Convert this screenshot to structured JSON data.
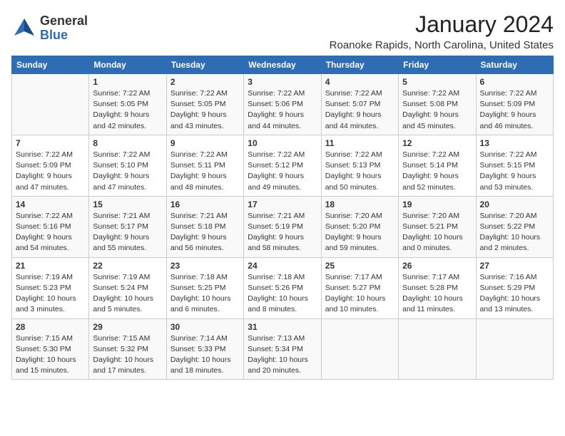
{
  "logo": {
    "general": "General",
    "blue": "Blue"
  },
  "title": "January 2024",
  "location": "Roanoke Rapids, North Carolina, United States",
  "weekdays": [
    "Sunday",
    "Monday",
    "Tuesday",
    "Wednesday",
    "Thursday",
    "Friday",
    "Saturday"
  ],
  "weeks": [
    [
      {
        "day": "",
        "info": ""
      },
      {
        "day": "1",
        "info": "Sunrise: 7:22 AM\nSunset: 5:05 PM\nDaylight: 9 hours\nand 42 minutes."
      },
      {
        "day": "2",
        "info": "Sunrise: 7:22 AM\nSunset: 5:05 PM\nDaylight: 9 hours\nand 43 minutes."
      },
      {
        "day": "3",
        "info": "Sunrise: 7:22 AM\nSunset: 5:06 PM\nDaylight: 9 hours\nand 44 minutes."
      },
      {
        "day": "4",
        "info": "Sunrise: 7:22 AM\nSunset: 5:07 PM\nDaylight: 9 hours\nand 44 minutes."
      },
      {
        "day": "5",
        "info": "Sunrise: 7:22 AM\nSunset: 5:08 PM\nDaylight: 9 hours\nand 45 minutes."
      },
      {
        "day": "6",
        "info": "Sunrise: 7:22 AM\nSunset: 5:09 PM\nDaylight: 9 hours\nand 46 minutes."
      }
    ],
    [
      {
        "day": "7",
        "info": "Sunrise: 7:22 AM\nSunset: 5:09 PM\nDaylight: 9 hours\nand 47 minutes."
      },
      {
        "day": "8",
        "info": "Sunrise: 7:22 AM\nSunset: 5:10 PM\nDaylight: 9 hours\nand 47 minutes."
      },
      {
        "day": "9",
        "info": "Sunrise: 7:22 AM\nSunset: 5:11 PM\nDaylight: 9 hours\nand 48 minutes."
      },
      {
        "day": "10",
        "info": "Sunrise: 7:22 AM\nSunset: 5:12 PM\nDaylight: 9 hours\nand 49 minutes."
      },
      {
        "day": "11",
        "info": "Sunrise: 7:22 AM\nSunset: 5:13 PM\nDaylight: 9 hours\nand 50 minutes."
      },
      {
        "day": "12",
        "info": "Sunrise: 7:22 AM\nSunset: 5:14 PM\nDaylight: 9 hours\nand 52 minutes."
      },
      {
        "day": "13",
        "info": "Sunrise: 7:22 AM\nSunset: 5:15 PM\nDaylight: 9 hours\nand 53 minutes."
      }
    ],
    [
      {
        "day": "14",
        "info": "Sunrise: 7:22 AM\nSunset: 5:16 PM\nDaylight: 9 hours\nand 54 minutes."
      },
      {
        "day": "15",
        "info": "Sunrise: 7:21 AM\nSunset: 5:17 PM\nDaylight: 9 hours\nand 55 minutes."
      },
      {
        "day": "16",
        "info": "Sunrise: 7:21 AM\nSunset: 5:18 PM\nDaylight: 9 hours\nand 56 minutes."
      },
      {
        "day": "17",
        "info": "Sunrise: 7:21 AM\nSunset: 5:19 PM\nDaylight: 9 hours\nand 58 minutes."
      },
      {
        "day": "18",
        "info": "Sunrise: 7:20 AM\nSunset: 5:20 PM\nDaylight: 9 hours\nand 59 minutes."
      },
      {
        "day": "19",
        "info": "Sunrise: 7:20 AM\nSunset: 5:21 PM\nDaylight: 10 hours\nand 0 minutes."
      },
      {
        "day": "20",
        "info": "Sunrise: 7:20 AM\nSunset: 5:22 PM\nDaylight: 10 hours\nand 2 minutes."
      }
    ],
    [
      {
        "day": "21",
        "info": "Sunrise: 7:19 AM\nSunset: 5:23 PM\nDaylight: 10 hours\nand 3 minutes."
      },
      {
        "day": "22",
        "info": "Sunrise: 7:19 AM\nSunset: 5:24 PM\nDaylight: 10 hours\nand 5 minutes."
      },
      {
        "day": "23",
        "info": "Sunrise: 7:18 AM\nSunset: 5:25 PM\nDaylight: 10 hours\nand 6 minutes."
      },
      {
        "day": "24",
        "info": "Sunrise: 7:18 AM\nSunset: 5:26 PM\nDaylight: 10 hours\nand 8 minutes."
      },
      {
        "day": "25",
        "info": "Sunrise: 7:17 AM\nSunset: 5:27 PM\nDaylight: 10 hours\nand 10 minutes."
      },
      {
        "day": "26",
        "info": "Sunrise: 7:17 AM\nSunset: 5:28 PM\nDaylight: 10 hours\nand 11 minutes."
      },
      {
        "day": "27",
        "info": "Sunrise: 7:16 AM\nSunset: 5:29 PM\nDaylight: 10 hours\nand 13 minutes."
      }
    ],
    [
      {
        "day": "28",
        "info": "Sunrise: 7:15 AM\nSunset: 5:30 PM\nDaylight: 10 hours\nand 15 minutes."
      },
      {
        "day": "29",
        "info": "Sunrise: 7:15 AM\nSunset: 5:32 PM\nDaylight: 10 hours\nand 17 minutes."
      },
      {
        "day": "30",
        "info": "Sunrise: 7:14 AM\nSunset: 5:33 PM\nDaylight: 10 hours\nand 18 minutes."
      },
      {
        "day": "31",
        "info": "Sunrise: 7:13 AM\nSunset: 5:34 PM\nDaylight: 10 hours\nand 20 minutes."
      },
      {
        "day": "",
        "info": ""
      },
      {
        "day": "",
        "info": ""
      },
      {
        "day": "",
        "info": ""
      }
    ]
  ]
}
